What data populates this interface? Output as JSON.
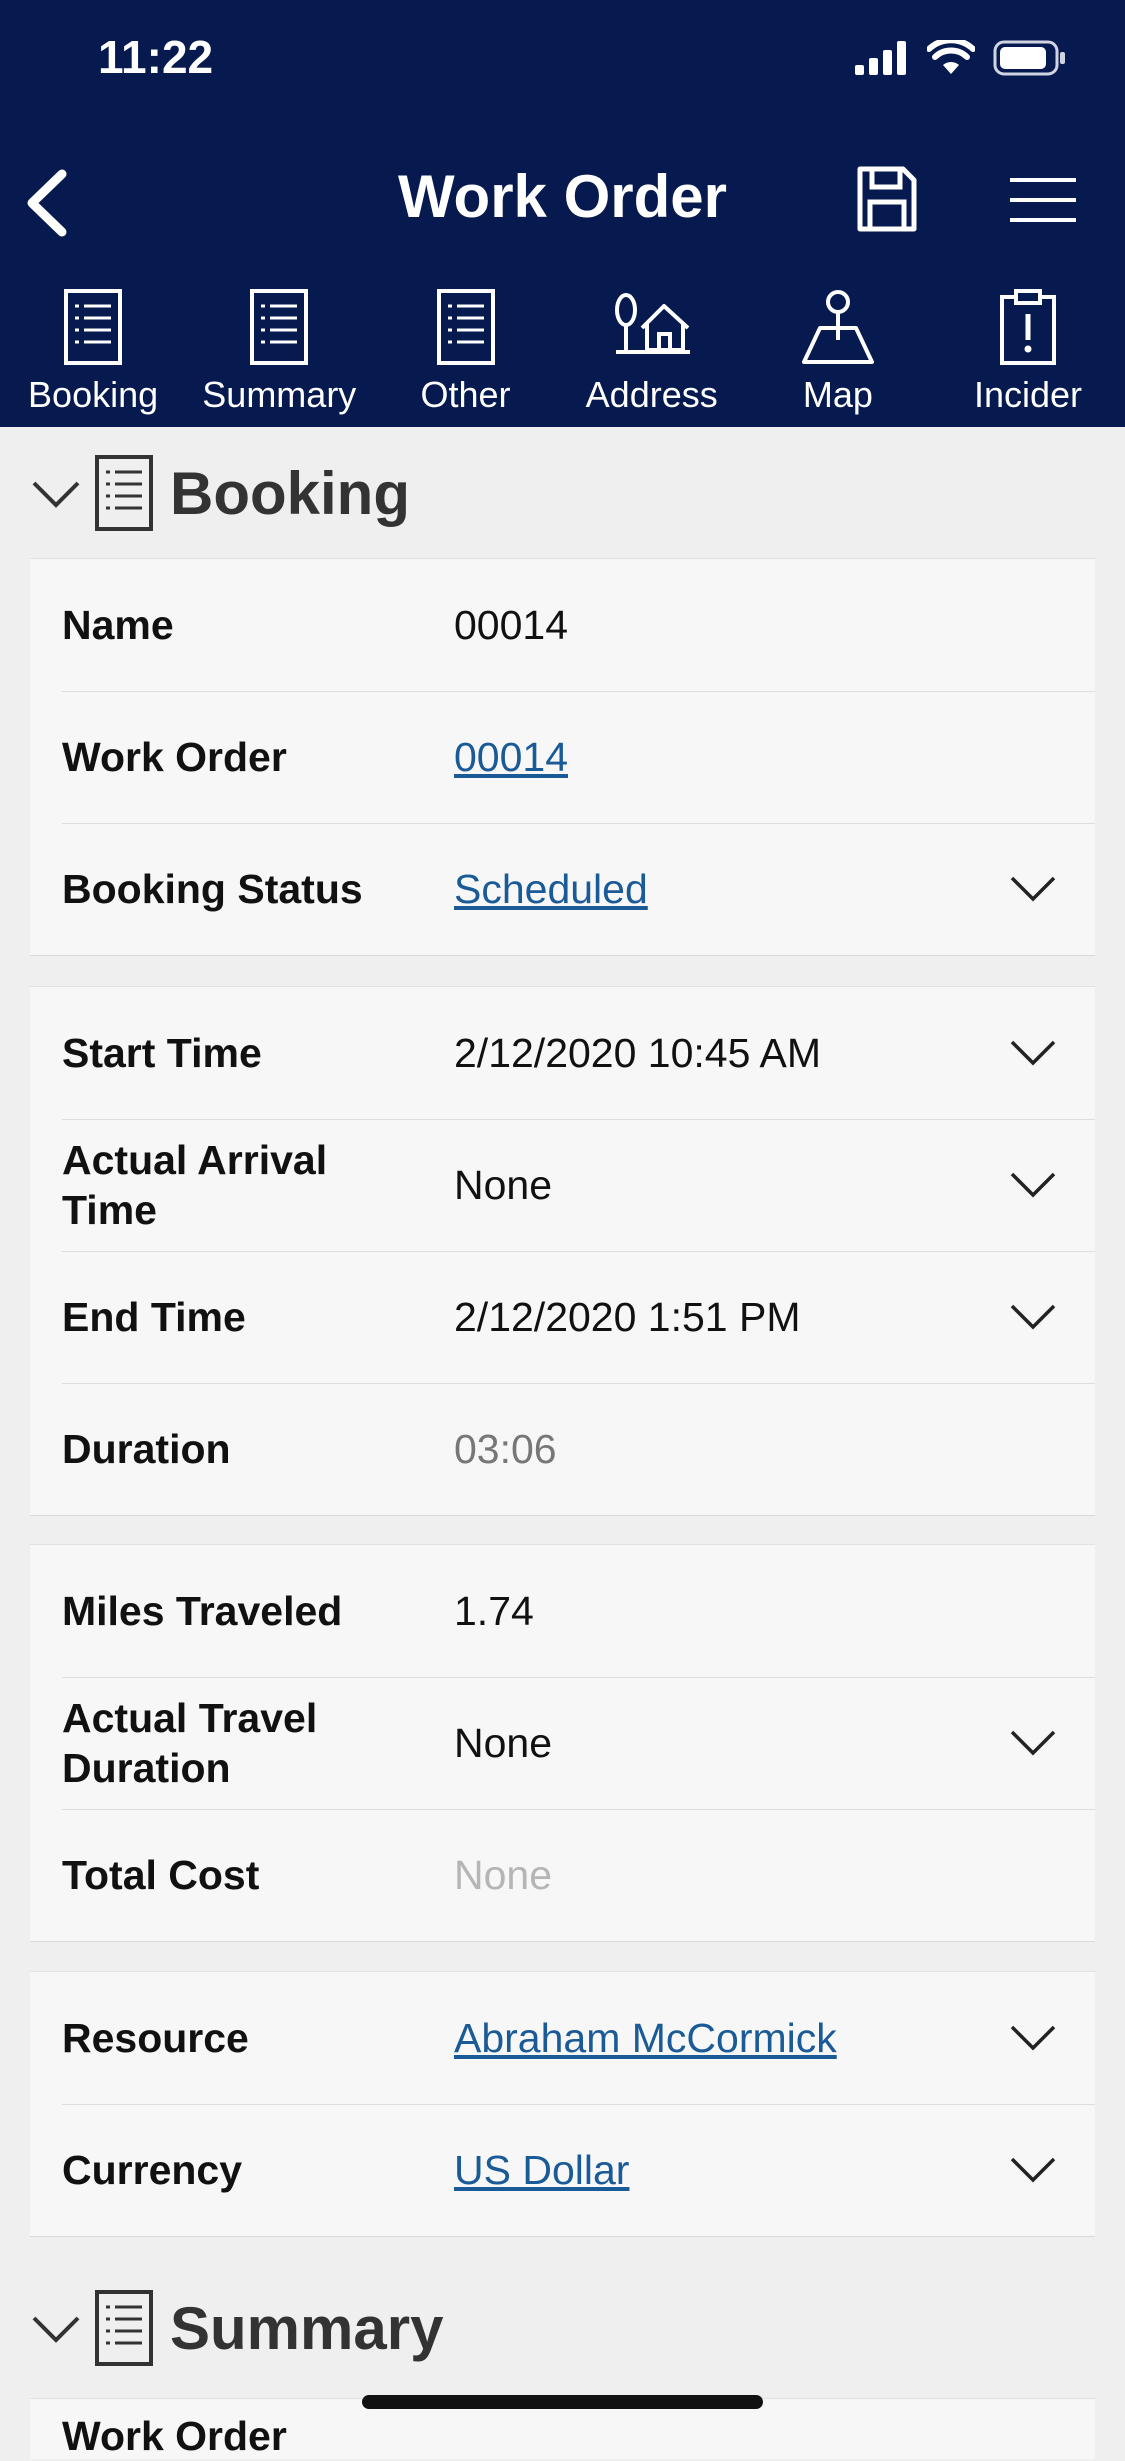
{
  "status_bar": {
    "time": "11:22"
  },
  "header": {
    "title": "Work Order"
  },
  "tabs": [
    {
      "label": "Booking",
      "icon": "document-icon"
    },
    {
      "label": "Summary",
      "icon": "document-icon"
    },
    {
      "label": "Other",
      "icon": "document-icon"
    },
    {
      "label": "Address",
      "icon": "address-icon"
    },
    {
      "label": "Map",
      "icon": "map-pin-icon"
    },
    {
      "label": "Incider",
      "icon": "clipboard-alert-icon"
    }
  ],
  "booking": {
    "title": "Booking",
    "group1": [
      {
        "label": "Name",
        "value": "00014"
      },
      {
        "label": "Work Order",
        "value": "00014"
      },
      {
        "label": "Booking Status",
        "value": "Scheduled"
      }
    ],
    "group2": [
      {
        "label": "Start Time",
        "value": "2/12/2020 10:45 AM"
      },
      {
        "label": "Actual Arrival Time",
        "value": "None"
      },
      {
        "label": "End Time",
        "value": "2/12/2020 1:51 PM"
      },
      {
        "label": "Duration",
        "value": "03:06"
      }
    ],
    "group3": [
      {
        "label": "Miles Traveled",
        "value": "1.74"
      },
      {
        "label": "Actual Travel Duration",
        "value": "None"
      },
      {
        "label": "Total Cost",
        "value": "None"
      }
    ],
    "group4": [
      {
        "label": "Resource",
        "value": "Abraham McCormick"
      },
      {
        "label": "Currency",
        "value": "US Dollar"
      }
    ]
  },
  "summary": {
    "title": "Summary",
    "first_label": "Work Order"
  }
}
